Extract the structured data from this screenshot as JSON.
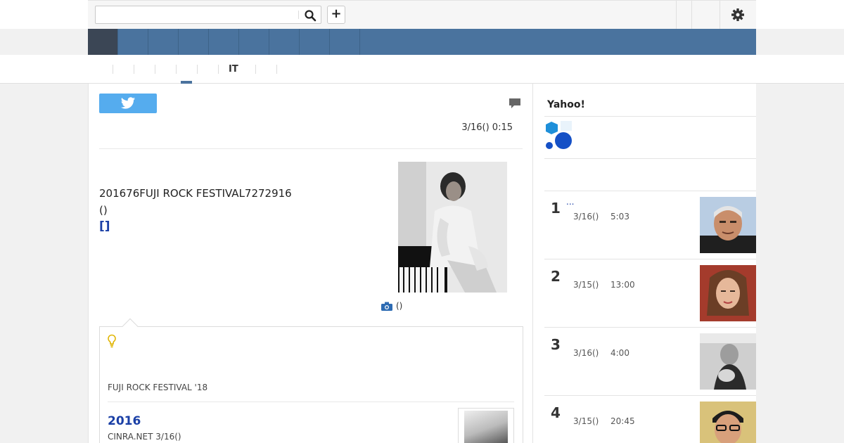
{
  "colors": {
    "nav": "#4a739e",
    "nav_active": "#3b4655",
    "link": "#1a3fa6",
    "tweet": "#55acee"
  },
  "search": {
    "value": "",
    "placeholder": ""
  },
  "header": {
    "plus_label": "+"
  },
  "subnav": {
    "active_label": "IT"
  },
  "article": {
    "date": "3/16() 0:15",
    "body_line1": "201676FUJI ROCK FESTIVAL7272916",
    "body_line2": "()",
    "body_link": "[]",
    "photo_caption": "()"
  },
  "related": {
    "tag": "FUJI ROCK FESTIVAL '18",
    "headline": "2016",
    "source": "CINRA.NET 3/16()"
  },
  "sidebar": {
    "title": "Yahoo!",
    "ranking": [
      {
        "rank": "1",
        "link": "...",
        "date": "3/16()",
        "time": "5:03"
      },
      {
        "rank": "2",
        "link": "",
        "date": "3/15()",
        "time": "13:00"
      },
      {
        "rank": "3",
        "link": "",
        "date": "3/16()",
        "time": "4:00"
      },
      {
        "rank": "4",
        "link": "",
        "date": "3/15()",
        "time": "20:45"
      }
    ]
  }
}
